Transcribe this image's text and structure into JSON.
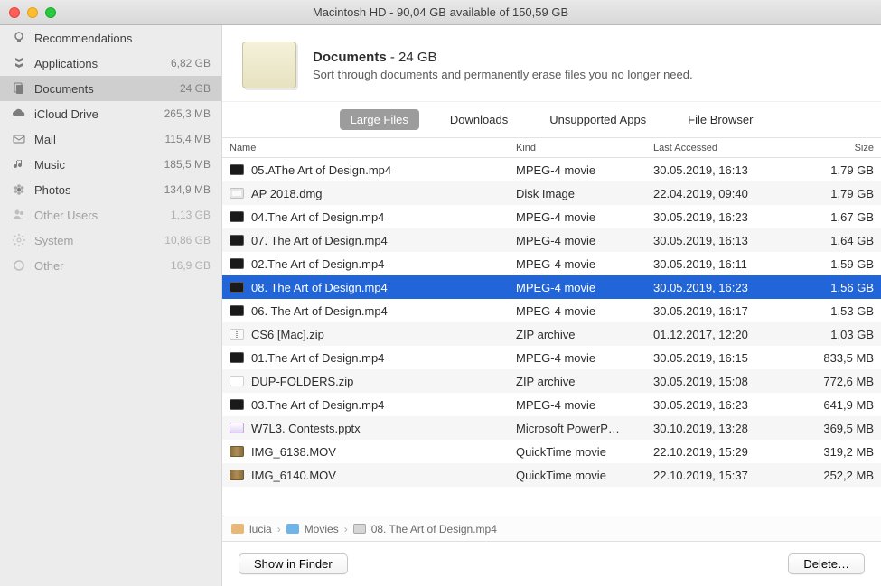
{
  "titlebar": {
    "title": "Macintosh HD - 90,04 GB available of 150,59 GB"
  },
  "sidebar": {
    "items": [
      {
        "label": "Recommendations",
        "icon": "bulb",
        "size": "",
        "dim": false
      },
      {
        "label": "Applications",
        "icon": "apps",
        "size": "6,82 GB",
        "dim": false
      },
      {
        "label": "Documents",
        "icon": "docs",
        "size": "24 GB",
        "dim": false,
        "selected": true
      },
      {
        "label": "iCloud Drive",
        "icon": "cloud",
        "size": "265,3 MB",
        "dim": false
      },
      {
        "label": "Mail",
        "icon": "mail",
        "size": "115,4 MB",
        "dim": false
      },
      {
        "label": "Music",
        "icon": "music",
        "size": "185,5 MB",
        "dim": false
      },
      {
        "label": "Photos",
        "icon": "photos",
        "size": "134,9 MB",
        "dim": false
      },
      {
        "label": "Other Users",
        "icon": "users",
        "size": "1,13 GB",
        "dim": true
      },
      {
        "label": "System",
        "icon": "gear",
        "size": "10,86 GB",
        "dim": true
      },
      {
        "label": "Other",
        "icon": "circle",
        "size": "16,9 GB",
        "dim": true
      }
    ]
  },
  "header": {
    "title_bold": "Documents",
    "title_size": "24 GB",
    "subtitle": "Sort through documents and permanently erase files you no longer need."
  },
  "tabs": [
    {
      "label": "Large Files",
      "active": true
    },
    {
      "label": "Downloads",
      "active": false
    },
    {
      "label": "Unsupported Apps",
      "active": false
    },
    {
      "label": "File Browser",
      "active": false
    }
  ],
  "columns": {
    "name": "Name",
    "kind": "Kind",
    "date": "Last Accessed",
    "size": "Size"
  },
  "rows": [
    {
      "name": "05.AThe Art of Design.mp4",
      "kind": "MPEG-4 movie",
      "date": "30.05.2019, 16:13",
      "size": "1,79 GB",
      "icon": "video"
    },
    {
      "name": "AP 2018.dmg",
      "kind": "Disk Image",
      "date": "22.04.2019, 09:40",
      "size": "1,79 GB",
      "icon": "dmg"
    },
    {
      "name": "04.The Art of Design.mp4",
      "kind": "MPEG-4 movie",
      "date": "30.05.2019, 16:23",
      "size": "1,67 GB",
      "icon": "video"
    },
    {
      "name": "07. The Art of Design.mp4",
      "kind": "MPEG-4 movie",
      "date": "30.05.2019, 16:13",
      "size": "1,64 GB",
      "icon": "video"
    },
    {
      "name": "02.The Art of Design.mp4",
      "kind": "MPEG-4 movie",
      "date": "30.05.2019, 16:11",
      "size": "1,59 GB",
      "icon": "video"
    },
    {
      "name": "08. The Art of Design.mp4",
      "kind": "MPEG-4 movie",
      "date": "30.05.2019, 16:23",
      "size": "1,56 GB",
      "icon": "video",
      "selected": true
    },
    {
      "name": "06. The Art of Design.mp4",
      "kind": "MPEG-4 movie",
      "date": "30.05.2019, 16:17",
      "size": "1,53 GB",
      "icon": "video"
    },
    {
      "name": "CS6 [Mac].zip",
      "kind": "ZIP archive",
      "date": "01.12.2017, 12:20",
      "size": "1,03 GB",
      "icon": "zip"
    },
    {
      "name": "01.The Art of Design.mp4",
      "kind": "MPEG-4 movie",
      "date": "30.05.2019, 16:15",
      "size": "833,5 MB",
      "icon": "video"
    },
    {
      "name": "DUP-FOLDERS.zip",
      "kind": "ZIP archive",
      "date": "30.05.2019, 15:08",
      "size": "772,6 MB",
      "icon": "doc"
    },
    {
      "name": "03.The Art of Design.mp4",
      "kind": "MPEG-4 movie",
      "date": "30.05.2019, 16:23",
      "size": "641,9 MB",
      "icon": "video"
    },
    {
      "name": "W7L3. Contests.pptx",
      "kind": "Microsoft PowerP…",
      "date": "30.10.2019, 13:28",
      "size": "369,5 MB",
      "icon": "pptx"
    },
    {
      "name": "IMG_6138.MOV",
      "kind": "QuickTime movie",
      "date": "22.10.2019, 15:29",
      "size": "319,2 MB",
      "icon": "mov"
    },
    {
      "name": "IMG_6140.MOV",
      "kind": "QuickTime movie",
      "date": "22.10.2019, 15:37",
      "size": "252,2 MB",
      "icon": "mov"
    }
  ],
  "breadcrumb": {
    "parts": [
      {
        "label": "lucia",
        "icon": "home"
      },
      {
        "label": "Movies",
        "icon": "folder"
      },
      {
        "label": "08. The Art of Design.mp4",
        "icon": "file"
      }
    ]
  },
  "footer": {
    "show_in_finder": "Show in Finder",
    "delete": "Delete…"
  }
}
